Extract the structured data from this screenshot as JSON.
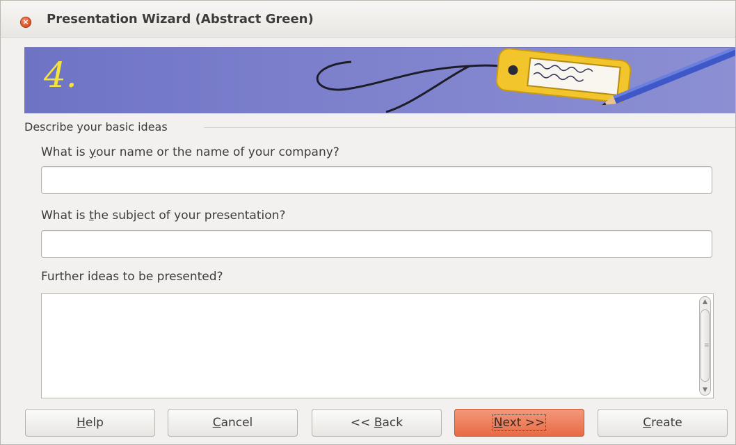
{
  "window": {
    "title": "Presentation Wizard (Abstract Green)",
    "close_glyph": "×"
  },
  "banner": {
    "step": "4."
  },
  "section": {
    "title": "Describe your basic ideas"
  },
  "fields": {
    "name": {
      "label_pre": "What is ",
      "label_key": "y",
      "label_post": "our name or the name of your company?",
      "value": ""
    },
    "subject": {
      "label_pre": "What is ",
      "label_key": "t",
      "label_post": "he subject of your presentation?",
      "value": ""
    },
    "ideas": {
      "label": "Further ideas to be presented?",
      "value": ""
    }
  },
  "buttons": {
    "help": {
      "key": "H",
      "rest": "elp"
    },
    "cancel": {
      "key": "C",
      "rest": "ancel"
    },
    "back": {
      "pre": "<< ",
      "key": "B",
      "rest": "ack"
    },
    "next": {
      "key": "N",
      "rest": "ext >>"
    },
    "create": {
      "key": "C",
      "rest": "reate"
    }
  },
  "colors": {
    "accent": "#e86b44",
    "banner": "#7c80cc",
    "step_number": "#f3e43c"
  },
  "icons": {
    "close": "close-icon",
    "scroll_up": "chevron-up-icon",
    "scroll_down": "chevron-down-icon"
  }
}
